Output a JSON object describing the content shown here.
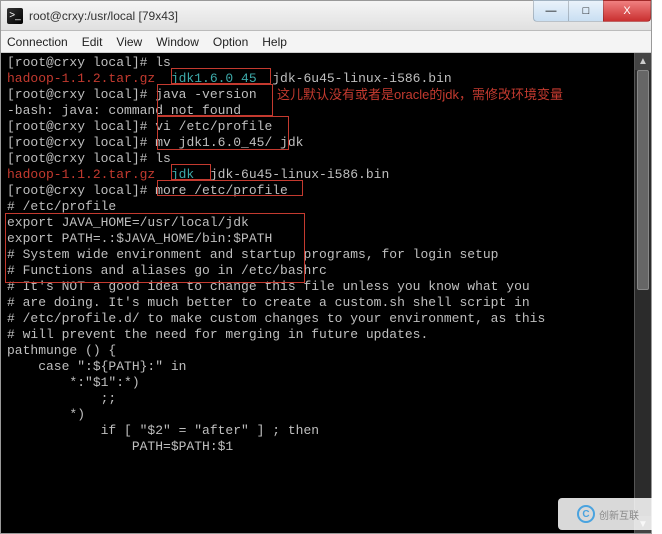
{
  "title": "root@crxy:/usr/local [79x43]",
  "menu": {
    "connection": "Connection",
    "edit": "Edit",
    "view": "View",
    "window": "Window",
    "option": "Option",
    "help": "Help"
  },
  "win_buttons": {
    "min": "—",
    "max": "□",
    "close": "X"
  },
  "annotation": "这儿默认没有或者是oracle的jdk，需修改环境变量",
  "watermark": "创新互联",
  "terminal": {
    "l0_prompt": "[root@crxy local]# ",
    "l0_cmd": "ls",
    "l1_a": "hadoop-1.1.2.tar.gz  ",
    "l1_b": "jdk1.6.0_45",
    "l1_c": "  jdk-6u45-linux-i586.bin",
    "l2_prompt": "[root@crxy local]# ",
    "l2_cmd": "java -version",
    "l3": "-bash: java: command not found",
    "l4_prompt": "[root@crxy local]# ",
    "l4_cmd": "vi /etc/profile",
    "l5_prompt": "[root@crxy local]# ",
    "l5_cmd": "mv jdk1.6.0_45/ jdk",
    "l6_prompt": "[root@crxy local]# ",
    "l6_cmd": "ls",
    "l7_a": "hadoop-1.1.2.tar.gz  ",
    "l7_b": "jdk",
    "l7_c": "  jdk-6u45-linux-i586.bin",
    "l8_prompt": "[root@crxy local]# ",
    "l8_cmd": "more /etc/profile",
    "l9": "# /etc/profile",
    "l10": "",
    "l11": "export JAVA_HOME=/usr/local/jdk",
    "l12": "export PATH=.:$JAVA_HOME/bin:$PATH",
    "l13": "",
    "l14": "",
    "l15": "# System wide environment and startup programs, for login setup",
    "l16": "# Functions and aliases go in /etc/bashrc",
    "l17": "",
    "l18": "# It's NOT a good idea to change this file unless you know what you",
    "l19": "# are doing. It's much better to create a custom.sh shell script in",
    "l20": "# /etc/profile.d/ to make custom changes to your environment, as this",
    "l21": "# will prevent the need for merging in future updates.",
    "l22": "",
    "l23": "pathmunge () {",
    "l24": "    case \":${PATH}:\" in",
    "l25": "        *:\"$1\":*)",
    "l26": "            ;;",
    "l27": "        *)",
    "l28": "            if [ \"$2\" = \"after\" ] ; then",
    "l29": "                PATH=$PATH:$1"
  }
}
